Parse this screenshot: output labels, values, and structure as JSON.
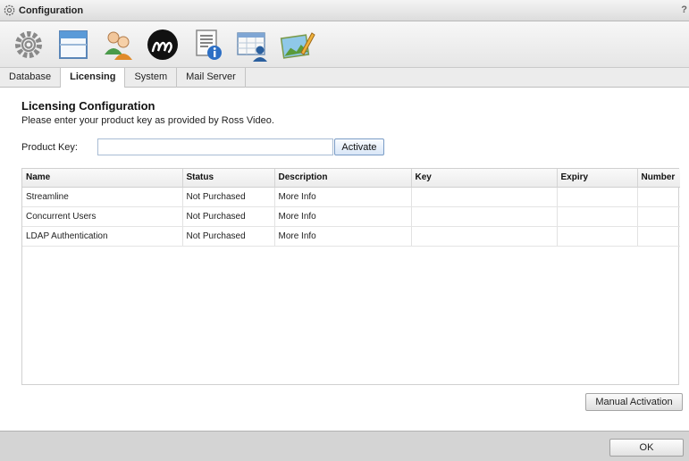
{
  "window": {
    "title": "Configuration",
    "help": "?"
  },
  "toolbar": {
    "icons": [
      "gear-icon",
      "window-icon",
      "users-icon",
      "ross-m-logo-icon",
      "info-document-icon",
      "calendar-user-icon",
      "image-pencil-icon"
    ]
  },
  "tabs": [
    {
      "label": "Database",
      "active": false
    },
    {
      "label": "Licensing",
      "active": true
    },
    {
      "label": "System",
      "active": false
    },
    {
      "label": "Mail Server",
      "active": false
    }
  ],
  "licensing": {
    "heading": "Licensing Configuration",
    "subtitle": "Please enter your product key as provided by Ross Video.",
    "product_key_label": "Product Key:",
    "product_key_value": "",
    "activate_label": "Activate",
    "manual_activation_label": "Manual Activation"
  },
  "table": {
    "columns": [
      "Name",
      "Status",
      "Description",
      "Key",
      "Expiry",
      "Number"
    ],
    "rows": [
      [
        "Streamline",
        "Not Purchased",
        "More Info",
        "",
        "",
        ""
      ],
      [
        "Concurrent Users",
        "Not Purchased",
        "More Info",
        "",
        "",
        ""
      ],
      [
        "LDAP Authentication",
        "Not Purchased",
        "More Info",
        "",
        "",
        ""
      ]
    ]
  },
  "footer": {
    "ok_label": "OK"
  },
  "colors": {
    "activate_border": "#7a9cc6",
    "input_border": "#a8bcd4",
    "footer_bg": "#d4d4d4"
  }
}
